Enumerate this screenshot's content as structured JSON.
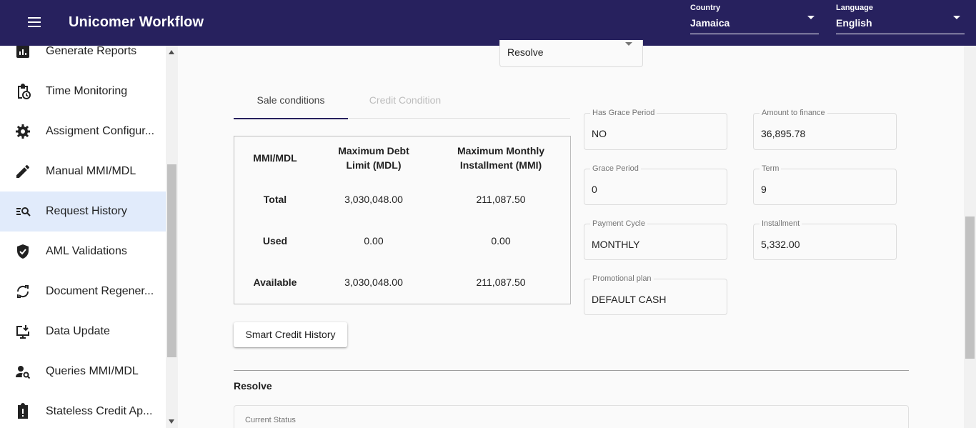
{
  "header": {
    "title": "Unicomer Workflow",
    "country": {
      "label": "Country",
      "value": "Jamaica"
    },
    "language": {
      "label": "Language",
      "value": "English"
    }
  },
  "sidebar": {
    "items": [
      {
        "label": "Generate Reports",
        "icon": "report-icon"
      },
      {
        "label": "Time Monitoring",
        "icon": "clipboard-clock-icon"
      },
      {
        "label": "Assigment Configur...",
        "icon": "gear-icon"
      },
      {
        "label": "Manual MMI/MDL",
        "icon": "pencil-icon"
      },
      {
        "label": "Request History",
        "icon": "search-list-icon",
        "active": true
      },
      {
        "label": "AML Validations",
        "icon": "shield-check-icon"
      },
      {
        "label": "Document Regener...",
        "icon": "refresh-icon"
      },
      {
        "label": "Data Update",
        "icon": "download-monitor-icon"
      },
      {
        "label": "Queries MMI/MDL",
        "icon": "person-search-icon"
      },
      {
        "label": "Stateless Credit Ap...",
        "icon": "clipboard-alert-icon"
      }
    ]
  },
  "main": {
    "top_select": {
      "value": "Resolve"
    },
    "tabs": [
      {
        "label": "Sale conditions",
        "active": true
      },
      {
        "label": "Credit Condition",
        "active": false
      }
    ],
    "mmi_table": {
      "headers": [
        "MMI/MDL",
        "Maximum Debt Limit (MDL)",
        "Maximum Monthly Installment (MMI)"
      ],
      "rows": [
        {
          "label": "Total",
          "mdl": "3,030,048.00",
          "mmi": "211,087.50"
        },
        {
          "label": "Used",
          "mdl": "0.00",
          "mmi": "0.00"
        },
        {
          "label": "Available",
          "mdl": "3,030,048.00",
          "mmi": "211,087.50"
        }
      ]
    },
    "fields": {
      "has_grace_period": {
        "label": "Has Grace Period",
        "value": "NO"
      },
      "amount_to_finance": {
        "label": "Amount to finance",
        "value": "36,895.78"
      },
      "grace_period": {
        "label": "Grace Period",
        "value": "0"
      },
      "term": {
        "label": "Term",
        "value": "9"
      },
      "payment_cycle": {
        "label": "Payment Cycle",
        "value": "MONTHLY"
      },
      "installment": {
        "label": "Installment",
        "value": "5,332.00"
      },
      "promotional_plan": {
        "label": "Promotional plan",
        "value": "DEFAULT CASH"
      }
    },
    "smart_credit_button": "Smart Credit History",
    "resolve_section": {
      "title": "Resolve",
      "current_status_label": "Current Status"
    }
  },
  "colors": {
    "brand": "#27215e",
    "active_item_bg": "#e1ebfb"
  }
}
